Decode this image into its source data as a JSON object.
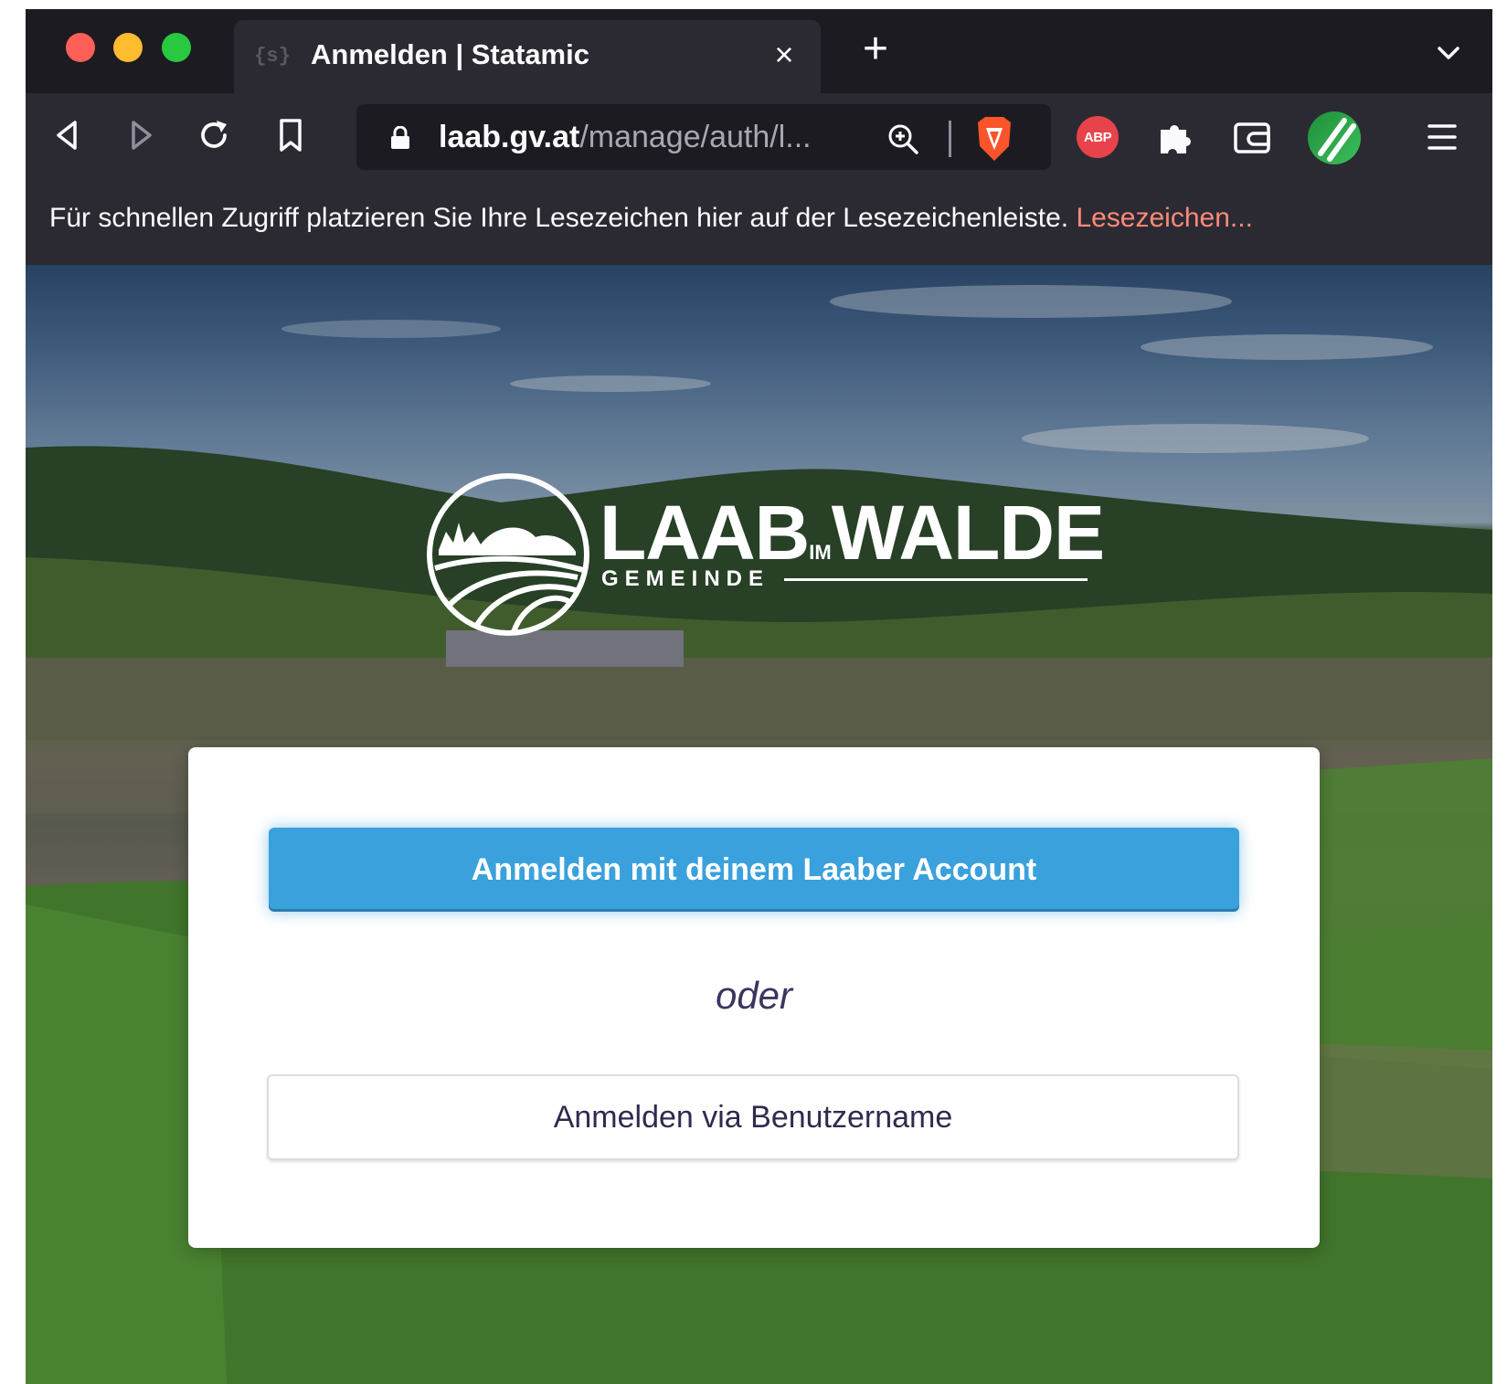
{
  "browser": {
    "tab": {
      "favicon_text": "{s}",
      "title": "Anmelden | Statamic",
      "close_label": "×"
    },
    "new_tab_label": "+",
    "url": {
      "host": "laab.gv.at",
      "path": "/manage/auth/l..."
    },
    "extensions": {
      "abp_label": "ABP"
    },
    "bookmarks_bar": {
      "message": "Für schnellen Zugriff platzieren Sie Ihre Lesezeichen hier auf der Lesezeichenleiste.",
      "link": "Lesezeichen..."
    }
  },
  "page": {
    "logo": {
      "name_part1": "LAAB",
      "name_small": "IM",
      "name_part2": "WALDE",
      "subtitle": "GEMEINDE"
    },
    "login": {
      "primary_button": "Anmelden mit deinem Laaber Account",
      "separator": "oder",
      "secondary_button": "Anmelden via Benutzername"
    }
  },
  "colors": {
    "primary_button": "#3aa1dd",
    "bookmark_link": "#ff8a78",
    "toolbar": "#2b2a33",
    "tabstrip": "#1c1b22"
  }
}
